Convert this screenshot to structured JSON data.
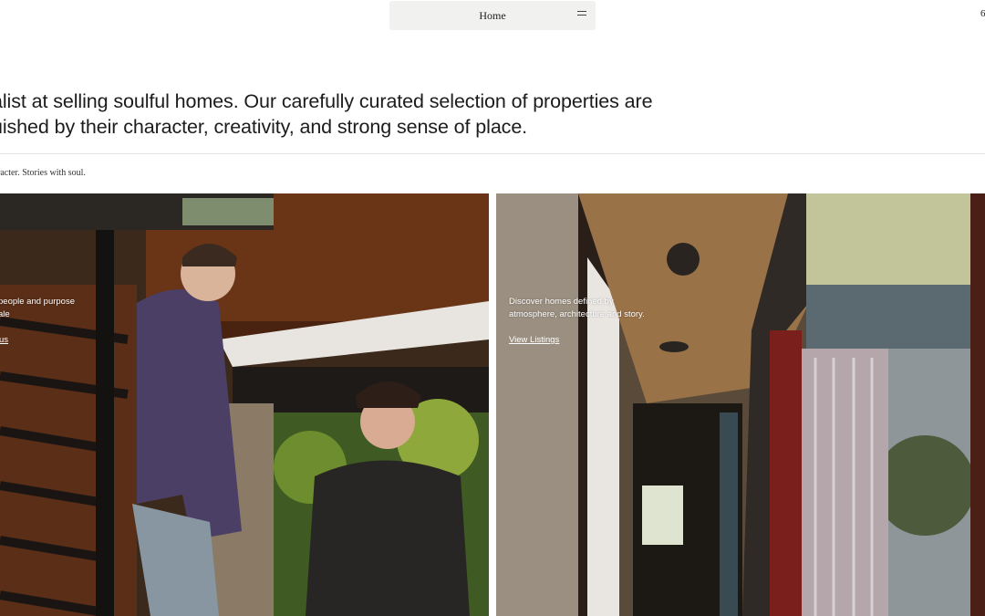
{
  "nav": {
    "label": "Home",
    "menu_icon": "hamburger-icon"
  },
  "corner_text": "6",
  "intro": {
    "line1": "alist at selling soulful homes. Our carefully curated selection of properties are",
    "line2": "uished by their character, creativity, and strong sense of place."
  },
  "tagline": "racter. Stories with soul.",
  "panels": {
    "left": {
      "line1": "people and purpose",
      "line2": "ale",
      "link": "us"
    },
    "right": {
      "line1": "Discover homes defined by",
      "line2": "atmosphere, architecture and story.",
      "link": "View Listings"
    }
  }
}
